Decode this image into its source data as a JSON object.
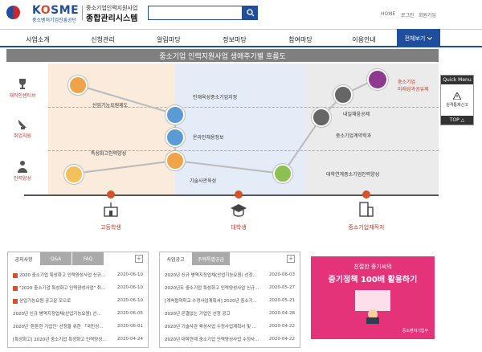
{
  "header": {
    "logo_text_k": "K",
    "logo_text_o": "O",
    "logo_text_rest": "SME",
    "logo_sub": "중소벤처기업진흥공단",
    "system_sub": "중소기업인력지원사업",
    "system_title": "종합관리시스템",
    "search_placeholder": "",
    "util_links": [
      "HOME",
      "로그인",
      "회원가입"
    ]
  },
  "nav": {
    "items": [
      "사업소개",
      "신청관리",
      "알림마당",
      "정보마당",
      "참여마당",
      "이용안내"
    ],
    "all_label": "전체보기"
  },
  "banner": {
    "title": "중소기업 인력지원사업 생애주기별 흐름도"
  },
  "diagram": {
    "row_labels": [
      "재직인센티브",
      "취업지원",
      "인력양성"
    ],
    "nodes": [
      {
        "label": "산업기능요원제도"
      },
      {
        "label": "특성화고인력양성"
      },
      {
        "label": "인재육성중소기업지정"
      },
      {
        "label": "온라인채용정보"
      },
      {
        "label": "기술사관육성"
      },
      {
        "label": "내일채움공제"
      },
      {
        "label": "중소기업계약학과"
      },
      {
        "label": "대학연계중소기업인력양성"
      }
    ],
    "highlight_label_1": "중소기업",
    "highlight_label_2": "재직자",
    "highlight_line_1": "중소기업",
    "highlight_line_2": "미래성과공유제",
    "bottom_labels": [
      "고등학생",
      "대학생",
      "중소기업재직자"
    ]
  },
  "quick_menu": {
    "title": "Quick Menu",
    "item": "원격통제신고",
    "top": "TOP △"
  },
  "notice_board": {
    "tabs": [
      "공지사항",
      "Q&A",
      "FAQ"
    ],
    "rows": [
      {
        "title": "2020 중소기업 특성화고 인력양성사업 신규...",
        "date": "2020-06-10",
        "icon": true
      },
      {
        "title": "\"2020 중소기업 특성화고 인력양성사업\" 취...",
        "date": "2020-06-10",
        "icon": true
      },
      {
        "title": "산업기능요원 공고문 모으로",
        "date": "2020-06-10",
        "icon": true
      },
      {
        "title": "2020년 신규 병역지정업체(산업기능요원) 선...",
        "date": "2020-06-05",
        "icon": false
      },
      {
        "title": "2020년 '튼튼한 기업인' 선정을 위한 「국민성...",
        "date": "2020-06-01",
        "icon": false
      },
      {
        "title": "[특성화고] 2020년 중소기업 특성화고 인력양성...",
        "date": "2020-04-24",
        "icon": false
      }
    ]
  },
  "biz_board": {
    "tabs": [
      "사업공고",
      "주택특별공급"
    ],
    "rows": [
      {
        "title": "2020년 신규 병역지정업체(산업기능요원) 선정...",
        "date": "2020-06-03"
      },
      {
        "title": "2020년도 중소기업 특성화고 인력양성사업 신규...",
        "date": "2020-05-27"
      },
      {
        "title": "[계속협약학교 수정사업계획서] 2020년 중소기...",
        "date": "2020-05-21"
      },
      {
        "title": "2020년 온결없는 기업인 선정 공고",
        "date": "2020-04-28"
      },
      {
        "title": "2020년 기술사관 육성사업 수정사업계획서 및 ...",
        "date": "2020-04-22"
      },
      {
        "title": "2020년 대학연계 중소기업 인력양성사업 수정사...",
        "date": "2020-04-22"
      }
    ]
  },
  "promo": {
    "line1": "친절한 중기씨의",
    "line2": "중기정책 100배 활용하기",
    "footer": "중소벤처기업부"
  },
  "colors": {
    "brand": "#1f4f9c",
    "accent": "#d35428",
    "promo": "#e5337a"
  }
}
